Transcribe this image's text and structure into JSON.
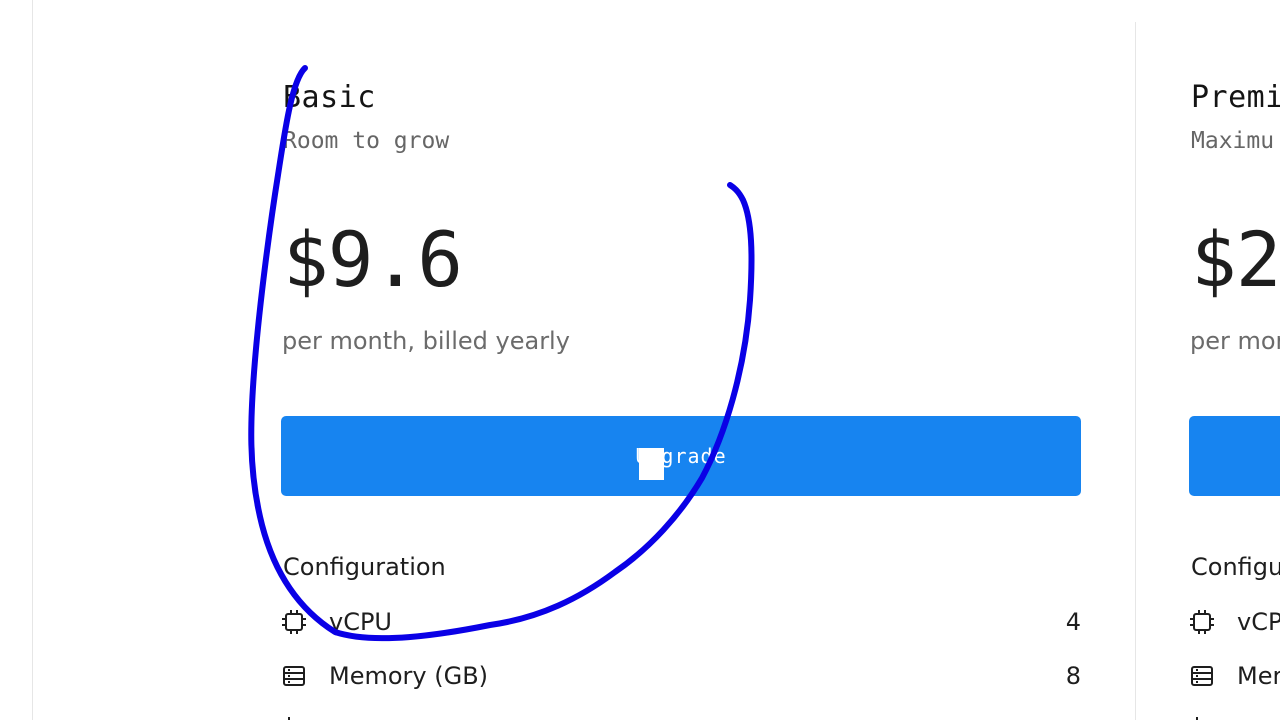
{
  "plans": {
    "basic": {
      "name": "Basic",
      "tagline": "Room to grow",
      "price": "$9.6",
      "billing": "per month, billed yearly",
      "cta_label": "Upgrade",
      "config_title": "Configuration",
      "specs": [
        {
          "label": "vCPU",
          "value": "4",
          "icon": "cpu-chip-icon"
        },
        {
          "label": "Memory (GB)",
          "value": "8",
          "icon": "memory-icon"
        },
        {
          "label": "",
          "value": "",
          "icon": "storage-icon"
        }
      ]
    },
    "premium": {
      "name": "Premi",
      "tagline": "Maximu",
      "price": "$2",
      "billing": "per mor",
      "cta_label": "",
      "config_title": "Configu",
      "specs": [
        {
          "label": "vCP",
          "value": "",
          "icon": "cpu-chip-icon"
        },
        {
          "label": "Mer",
          "value": "",
          "icon": "memory-icon"
        },
        {
          "label": "",
          "value": "",
          "icon": "storage-icon"
        }
      ]
    }
  },
  "colors": {
    "accent": "#1784f0",
    "annotation_ink": "#0a00e6",
    "muted_text": "#6b6b6b",
    "divider": "#e6e6e6"
  }
}
